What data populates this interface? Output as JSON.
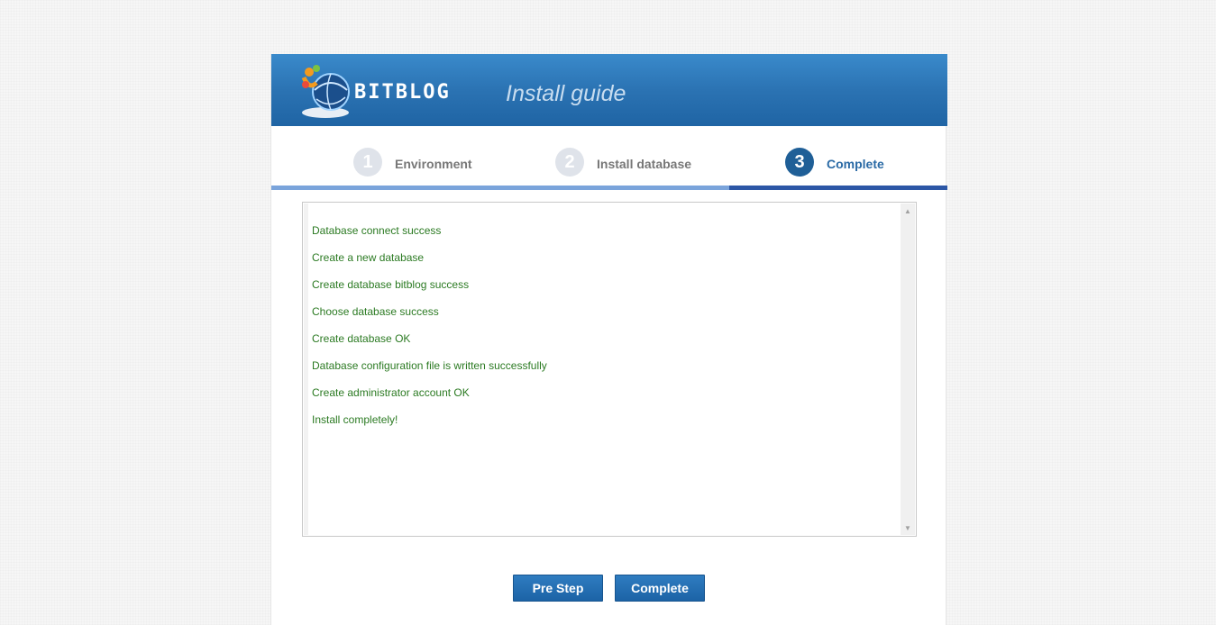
{
  "header": {
    "brand": "BITBLOG",
    "title": "Install guide"
  },
  "steps": [
    {
      "number": "1",
      "label": "Environment",
      "active": false
    },
    {
      "number": "2",
      "label": "Install database",
      "active": false
    },
    {
      "number": "3",
      "label": "Complete",
      "active": true
    }
  ],
  "progress": {
    "current_step": 3,
    "total_steps": 3
  },
  "log": [
    "Database connect success",
    "Create a new database",
    "Create database bitblog success",
    "Choose database success",
    "Create database OK",
    "Database configuration file is written successfully",
    "Create administrator account OK",
    "Install completely!"
  ],
  "buttons": {
    "pre_step": "Pre Step",
    "complete": "Complete"
  },
  "colors": {
    "header_blue": "#2b73b3",
    "active_step": "#1f5f97",
    "log_text": "#2b7a22",
    "button_blue": "#1c63a6"
  },
  "icons": {
    "logo": "globe-logo-icon",
    "scroll_up": "triangle-up-icon",
    "scroll_down": "triangle-down-icon"
  }
}
